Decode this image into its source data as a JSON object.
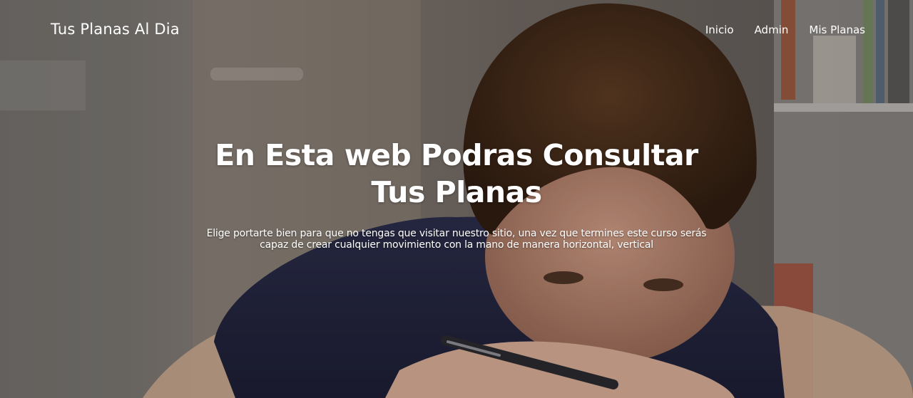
{
  "navbar": {
    "brand": "Tus Planas Al Dia",
    "links": [
      {
        "label": "Inicio"
      },
      {
        "label": "Admin"
      },
      {
        "label": "Mis Planas"
      }
    ]
  },
  "hero": {
    "title_line1": "En Esta web Podras Consultar",
    "title_line2": "Tus Planas",
    "description": "Elige portarte bien para que no tengas que visitar nuestro sitio, una vez que termines este curso serás capaz de crear cualquier movimiento con la mano de manera horizontal, vertical",
    "background_subject": "boy-resting-head-on-arms-holding-pen"
  },
  "colors": {
    "text": "#ffffff",
    "overlay": "#000000"
  }
}
